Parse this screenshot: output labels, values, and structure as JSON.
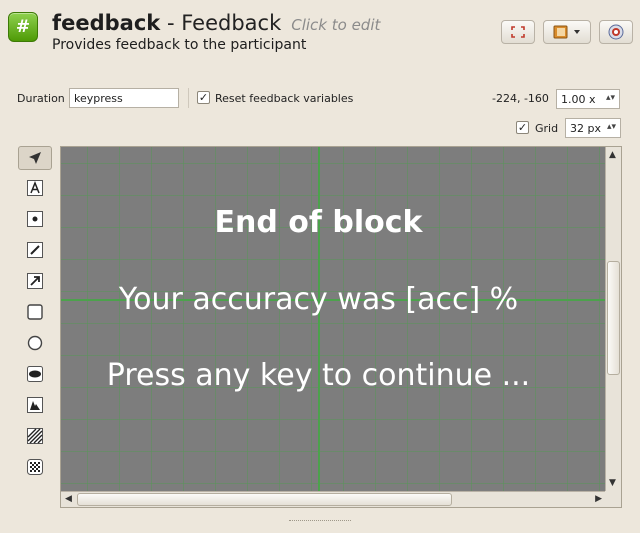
{
  "header": {
    "item_name": "feedback",
    "separator": " - ",
    "item_type": "Feedback",
    "edit_hint": "Click to edit",
    "description": "Provides feedback to the participant"
  },
  "toolbar": {
    "icons": [
      "fullscreen-icon",
      "notes-dropdown-icon",
      "help-icon"
    ]
  },
  "settings": {
    "duration_label": "Duration",
    "duration_value": "keypress",
    "reset_checkbox_label": "Reset feedback variables",
    "reset_checked": true,
    "cursor_coords": "-224, -160",
    "zoom_value": "1.00 x",
    "grid_label": "Grid",
    "grid_checked": true,
    "grid_value": "32 px"
  },
  "tools": [
    "arrow-select-icon",
    "text-tool-icon",
    "fixation-dot-icon",
    "line-tool-icon",
    "arrow-tool-icon",
    "rectangle-tool-icon",
    "circle-tool-icon",
    "ellipse-tool-icon",
    "image-tool-icon",
    "gabor-tool-icon",
    "noise-patch-icon"
  ],
  "canvas": {
    "background": "#7d7d7d",
    "grid_color": "#5a965a",
    "axis_color": "#4ca24c",
    "texts": {
      "heading": "End of block",
      "accuracy": "Your accuracy was [acc] %",
      "continue": "Press any key to continue ..."
    }
  }
}
